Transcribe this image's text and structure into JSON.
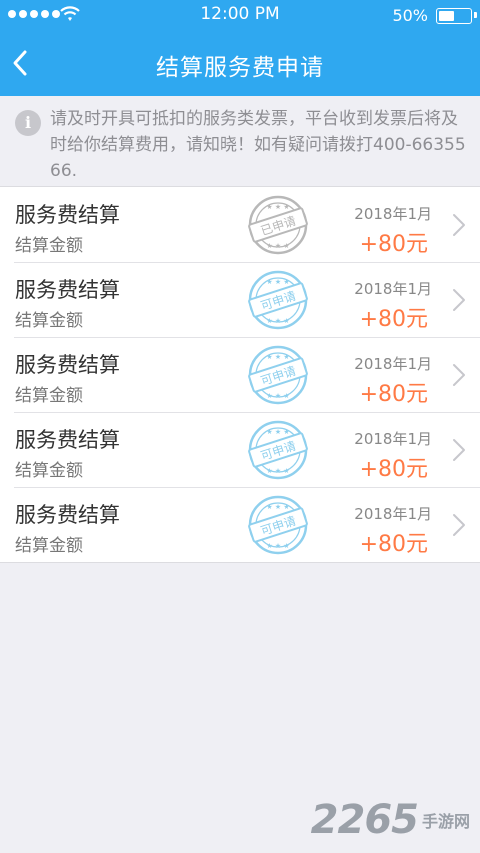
{
  "status_bar": {
    "time": "12:00 PM",
    "battery": "50%",
    "battery_level": 0.5
  },
  "header": {
    "title": "结算服务费申请",
    "back_icon": "chevron-left-icon"
  },
  "notice": {
    "icon": "info-icon",
    "icon_glyph": "i",
    "text": "请及时开具可抵扣的服务类发票，平台收到发票后将及时给你结算费用，请知晓！如有疑问请拨打400-6635566."
  },
  "items": [
    {
      "title": "服务费结算",
      "subtitle": "结算金额",
      "stamp": "已申请",
      "stamp_color": "#b8b8b8",
      "date": "2018年1月",
      "amount": "+80元"
    },
    {
      "title": "服务费结算",
      "subtitle": "结算金额",
      "stamp": "可申请",
      "stamp_color": "#8fd0ee",
      "date": "2018年1月",
      "amount": "+80元"
    },
    {
      "title": "服务费结算",
      "subtitle": "结算金额",
      "stamp": "可申请",
      "stamp_color": "#8fd0ee",
      "date": "2018年1月",
      "amount": "+80元"
    },
    {
      "title": "服务费结算",
      "subtitle": "结算金额",
      "stamp": "可申请",
      "stamp_color": "#8fd0ee",
      "date": "2018年1月",
      "amount": "+80元"
    },
    {
      "title": "服务费结算",
      "subtitle": "结算金额",
      "stamp": "可申请",
      "stamp_color": "#8fd0ee",
      "date": "2018年1月",
      "amount": "+80元"
    }
  ],
  "watermark": {
    "digits": "2265",
    "text": "手游网"
  },
  "colors": {
    "header_bg": "#2fa8f0",
    "amount": "#ff7a45",
    "page_bg": "#efeff4"
  }
}
